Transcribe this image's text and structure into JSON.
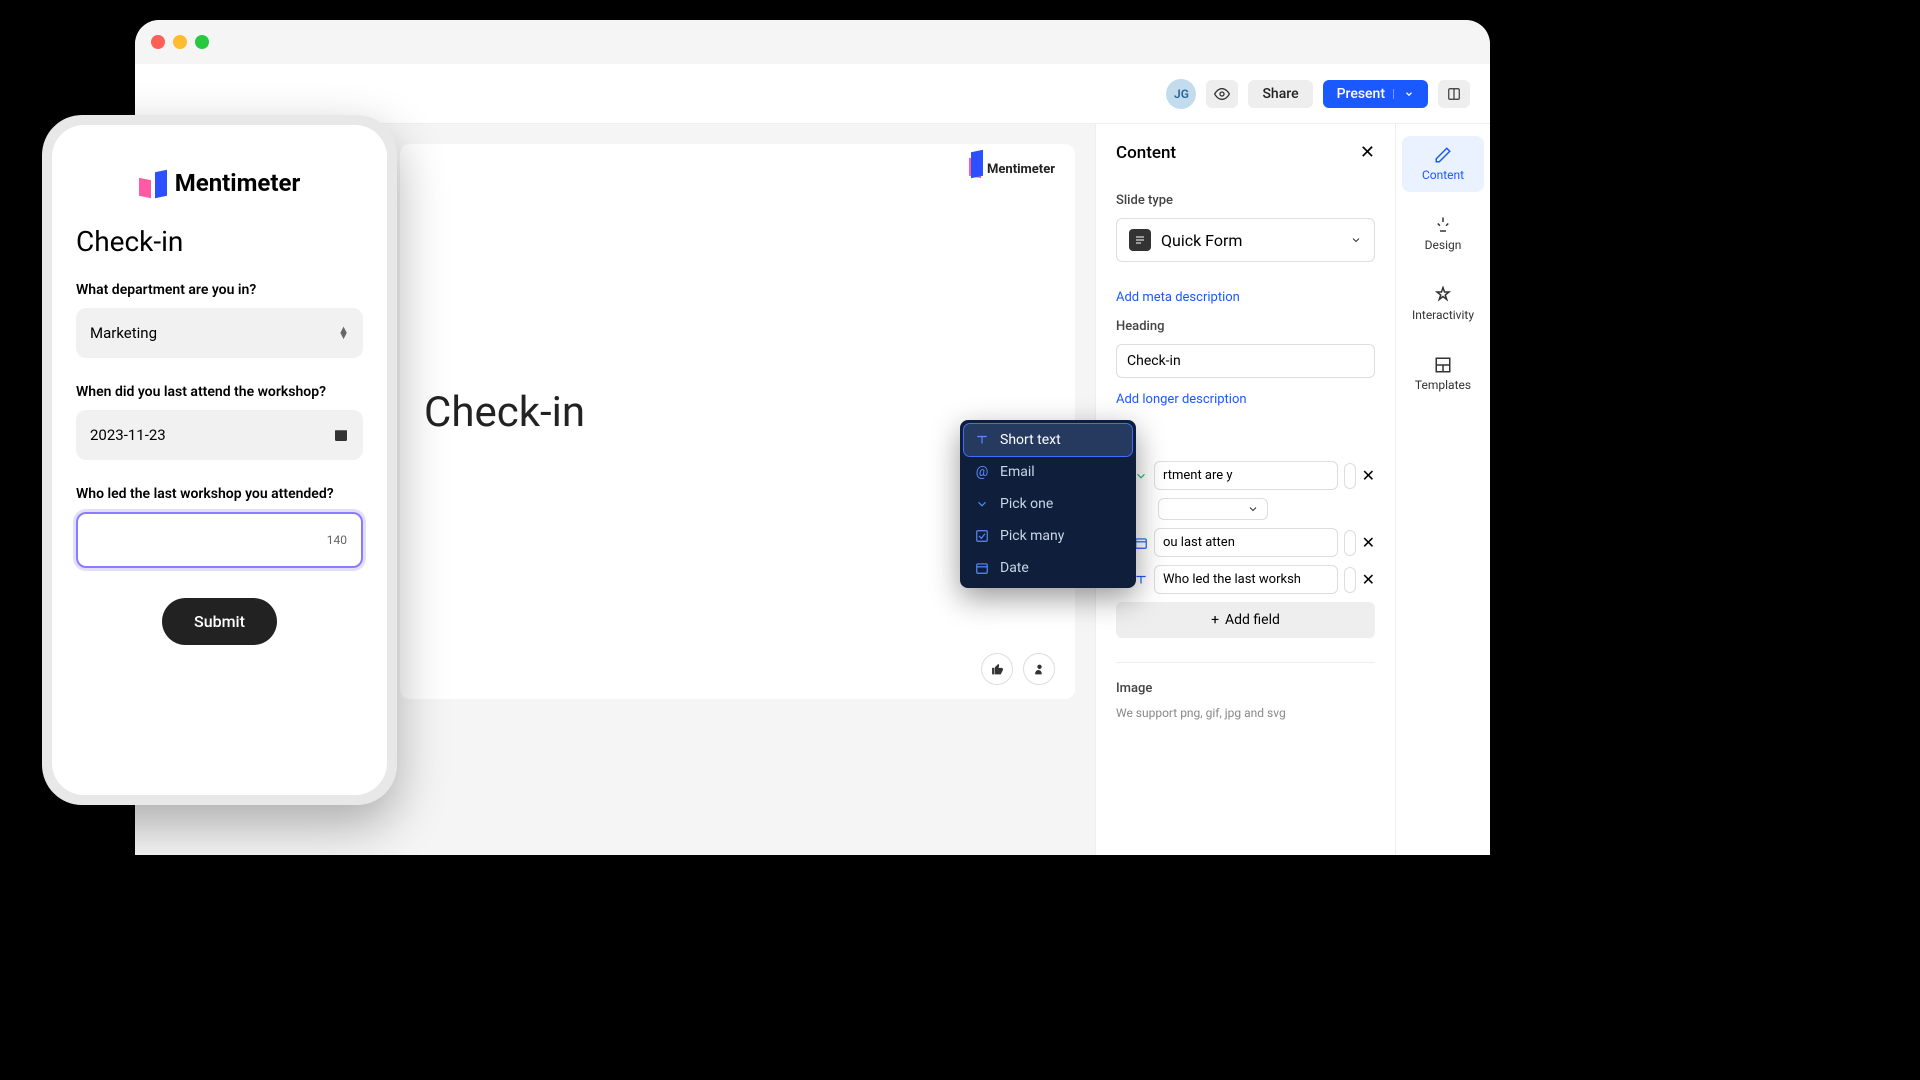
{
  "toolbar": {
    "avatar_initials": "JG",
    "share_label": "Share",
    "present_label": "Present"
  },
  "slide": {
    "brand_name": "Mentimeter",
    "title": "Check-in"
  },
  "rail": {
    "items": [
      "Content",
      "Design",
      "Interactivity",
      "Templates"
    ]
  },
  "panel": {
    "title": "Content",
    "slide_type_label": "Slide type",
    "slide_type_value": "Quick Form",
    "add_meta_link": "Add meta description",
    "heading_label": "Heading",
    "heading_value": "Check-in",
    "add_longer_link": "Add longer description",
    "fields": [
      {
        "label": "What department are you in?"
      },
      {
        "label": "When did you last attend the workshop?"
      },
      {
        "label": "Who led the last workshop you attended?"
      }
    ],
    "field0_display": "rtment are y",
    "field1_display": "ou last atten",
    "field2_display": "Who led the last worksh",
    "add_field_label": "Add field",
    "image_label": "Image",
    "image_sub": "We support png, gif, jpg and svg"
  },
  "field_menu": {
    "items": [
      "Short text",
      "Email",
      "Pick one",
      "Pick many",
      "Date"
    ]
  },
  "phone": {
    "brand": "Mentimeter",
    "title": "Check-in",
    "q1_label": "What department are you in?",
    "q1_value": "Marketing",
    "q2_label": "When did you last attend the workshop?",
    "q2_value": "2023-11-23",
    "q3_label": "Who led the last workshop you attended?",
    "q3_counter": "140",
    "submit_label": "Submit"
  }
}
